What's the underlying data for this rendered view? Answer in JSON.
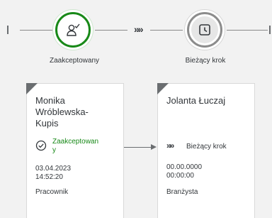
{
  "steps": [
    {
      "label": "Zaakceptowany",
      "icon": "user-check-icon",
      "status": "accepted",
      "color": "#188918",
      "card": {
        "name": "Monika\nWróblewska-\nKupis",
        "status_text": "Zaakceptowan\ny",
        "date": "03.04.2023",
        "time": "14:52:20",
        "role": "Pracownik"
      }
    },
    {
      "label": "Bieżący krok",
      "icon": "clock-icon",
      "status": "current",
      "color": "#8c8c8c",
      "card": {
        "name": "Jolanta Łuczaj",
        "status_text": "Bieżący krok",
        "date": "00.00.0000",
        "time": "00:00:00",
        "role": "Branżysta"
      }
    }
  ],
  "connector_glyph": "»»"
}
